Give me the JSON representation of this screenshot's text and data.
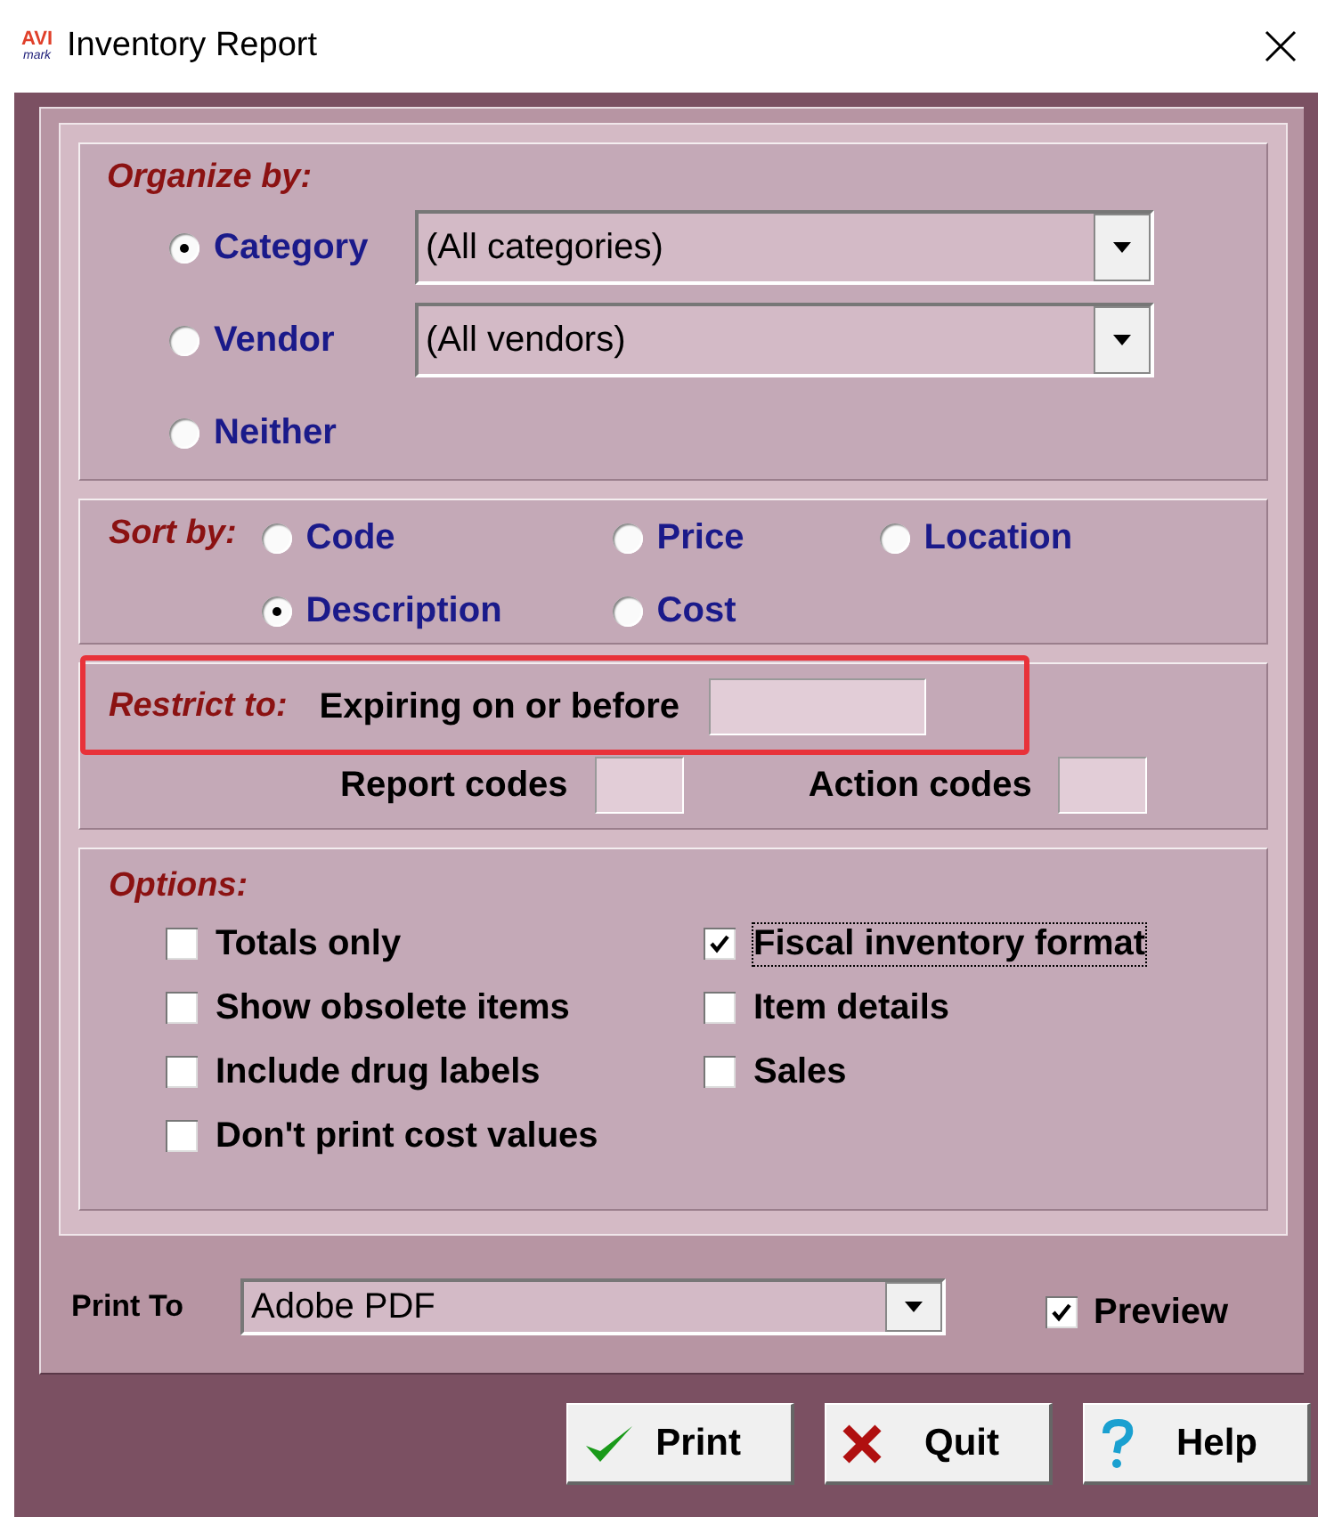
{
  "window": {
    "title": "Inventory Report",
    "logo": {
      "top": "AVI",
      "bottom": "mark"
    }
  },
  "organize_by": {
    "label": "Organize by:",
    "options": [
      {
        "label": "Category",
        "selected": true,
        "dropdown": "(All categories)"
      },
      {
        "label": "Vendor",
        "selected": false,
        "dropdown": "(All vendors)"
      },
      {
        "label": "Neither",
        "selected": false
      }
    ]
  },
  "sort_by": {
    "label": "Sort by:",
    "options": [
      {
        "label": "Code",
        "selected": false
      },
      {
        "label": "Price",
        "selected": false
      },
      {
        "label": "Location",
        "selected": false
      },
      {
        "label": "Description",
        "selected": true
      },
      {
        "label": "Cost",
        "selected": false
      }
    ]
  },
  "restrict_to": {
    "label": "Restrict to:",
    "highlighted": true,
    "fields": [
      {
        "label": "Expiring on or before",
        "kind": "wide"
      },
      {
        "label": "Report codes",
        "kind": "narrow"
      },
      {
        "label": "Action codes",
        "kind": "narrow"
      }
    ]
  },
  "options": {
    "label": "Options:",
    "items": [
      {
        "label": "Totals only",
        "checked": false,
        "focused": false
      },
      {
        "label": "Fiscal inventory format",
        "checked": true,
        "focused": true
      },
      {
        "label": "Show obsolete items",
        "checked": false,
        "focused": false
      },
      {
        "label": "Item details",
        "checked": false,
        "focused": false
      },
      {
        "label": "Include drug labels",
        "checked": false,
        "focused": false
      },
      {
        "label": "Sales",
        "checked": false,
        "focused": false
      },
      {
        "label": "Don't print cost values",
        "checked": false,
        "focused": false
      }
    ]
  },
  "print_to": {
    "label": "Print To",
    "value": "Adobe PDF"
  },
  "preview": {
    "label": "Preview",
    "checked": true
  },
  "buttons": [
    {
      "label": "Print",
      "kind": "print"
    },
    {
      "label": "Quit",
      "kind": "quit"
    },
    {
      "label": "Help",
      "kind": "help"
    }
  ]
}
